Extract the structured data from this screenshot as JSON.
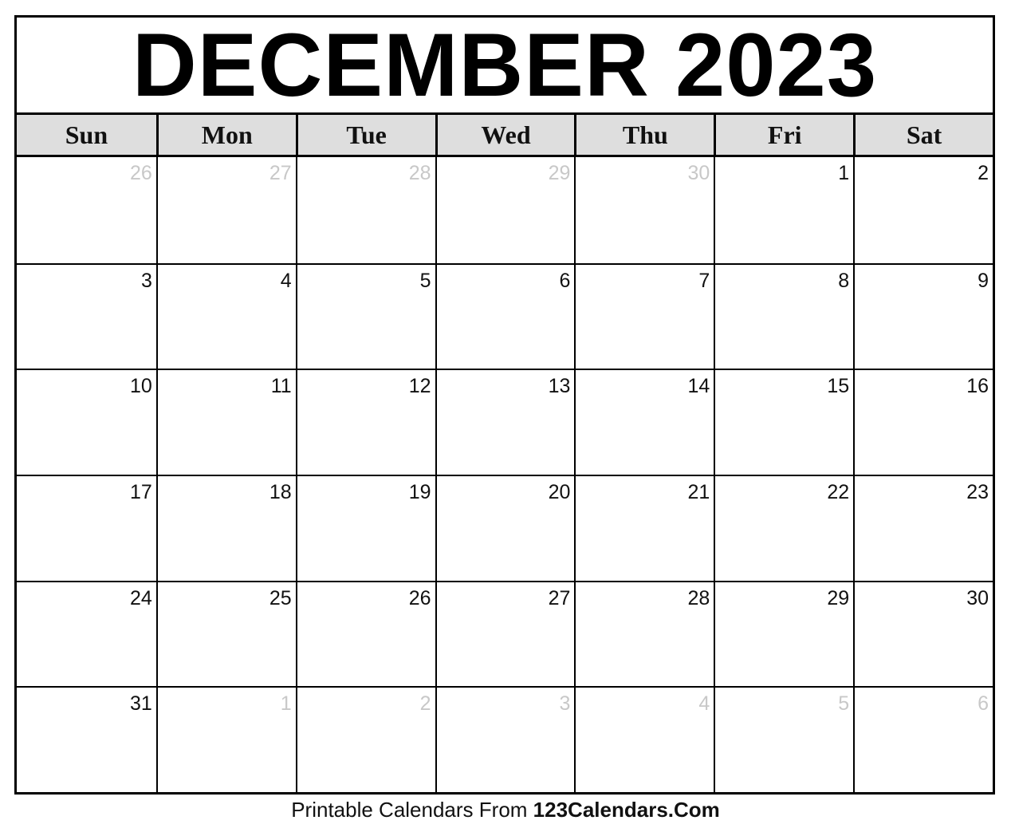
{
  "title": "DECEMBER 2023",
  "weekdays": [
    "Sun",
    "Mon",
    "Tue",
    "Wed",
    "Thu",
    "Fri",
    "Sat"
  ],
  "weeks": [
    [
      {
        "day": "26",
        "current": false
      },
      {
        "day": "27",
        "current": false
      },
      {
        "day": "28",
        "current": false
      },
      {
        "day": "29",
        "current": false
      },
      {
        "day": "30",
        "current": false
      },
      {
        "day": "1",
        "current": true
      },
      {
        "day": "2",
        "current": true
      }
    ],
    [
      {
        "day": "3",
        "current": true
      },
      {
        "day": "4",
        "current": true
      },
      {
        "day": "5",
        "current": true
      },
      {
        "day": "6",
        "current": true
      },
      {
        "day": "7",
        "current": true
      },
      {
        "day": "8",
        "current": true
      },
      {
        "day": "9",
        "current": true
      }
    ],
    [
      {
        "day": "10",
        "current": true
      },
      {
        "day": "11",
        "current": true
      },
      {
        "day": "12",
        "current": true
      },
      {
        "day": "13",
        "current": true
      },
      {
        "day": "14",
        "current": true
      },
      {
        "day": "15",
        "current": true
      },
      {
        "day": "16",
        "current": true
      }
    ],
    [
      {
        "day": "17",
        "current": true
      },
      {
        "day": "18",
        "current": true
      },
      {
        "day": "19",
        "current": true
      },
      {
        "day": "20",
        "current": true
      },
      {
        "day": "21",
        "current": true
      },
      {
        "day": "22",
        "current": true
      },
      {
        "day": "23",
        "current": true
      }
    ],
    [
      {
        "day": "24",
        "current": true
      },
      {
        "day": "25",
        "current": true
      },
      {
        "day": "26",
        "current": true
      },
      {
        "day": "27",
        "current": true
      },
      {
        "day": "28",
        "current": true
      },
      {
        "day": "29",
        "current": true
      },
      {
        "day": "30",
        "current": true
      }
    ],
    [
      {
        "day": "31",
        "current": true
      },
      {
        "day": "1",
        "current": false
      },
      {
        "day": "2",
        "current": false
      },
      {
        "day": "3",
        "current": false
      },
      {
        "day": "4",
        "current": false
      },
      {
        "day": "5",
        "current": false
      },
      {
        "day": "6",
        "current": false
      }
    ]
  ],
  "footer": {
    "prefix": "Printable Calendars From ",
    "brand": "123Calendars.Com"
  },
  "colors": {
    "header_bg": "#dedede",
    "outside_month_day": "#c8c8c8",
    "border": "#000000"
  }
}
